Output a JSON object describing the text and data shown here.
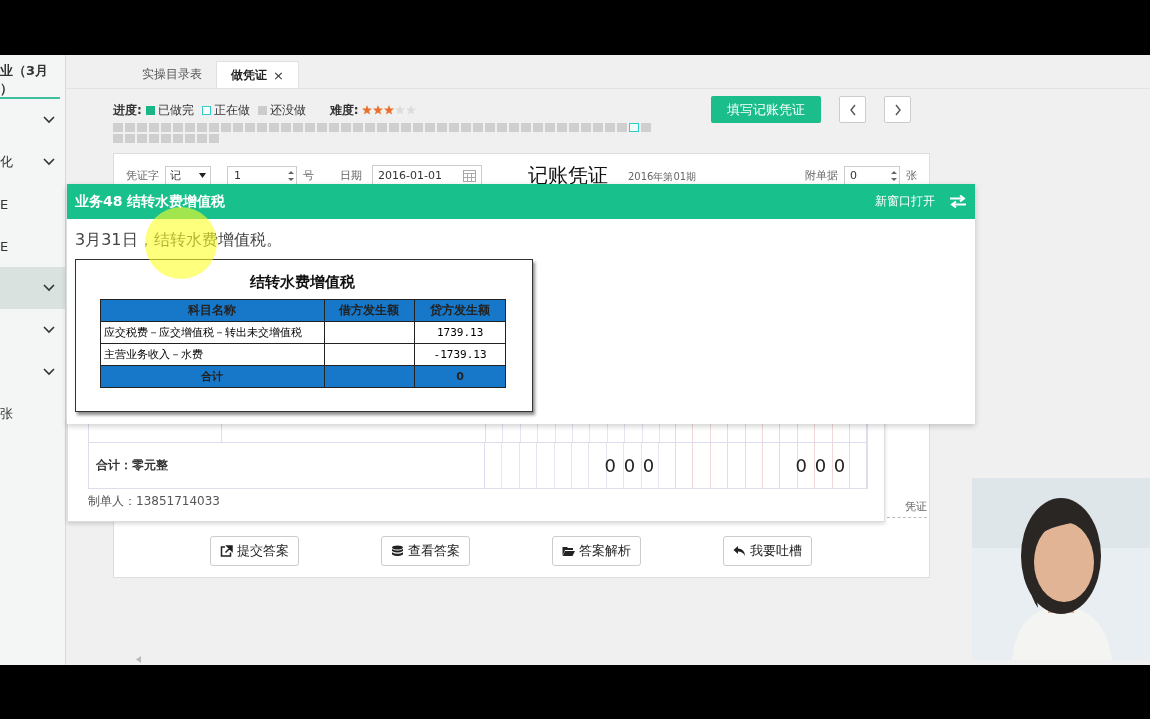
{
  "sidebar": {
    "header": [
      "业（3月",
      "）"
    ],
    "items": [
      {
        "kind": "group",
        "selected": false
      },
      {
        "kind": "group",
        "label": "化",
        "selected": false
      },
      {
        "kind": "link",
        "label": "E",
        "selected": false
      },
      {
        "kind": "link",
        "label": "E",
        "selected": false
      },
      {
        "kind": "group",
        "selected": true
      },
      {
        "kind": "group",
        "selected": false
      },
      {
        "kind": "group",
        "selected": false
      },
      {
        "kind": "link",
        "label": "张",
        "selected": false
      }
    ]
  },
  "tabs": [
    {
      "label": "实操目录表",
      "selected": false
    },
    {
      "label": "做凭证",
      "selected": true,
      "close": "×"
    }
  ],
  "progress": {
    "label": "进度:",
    "legend": [
      {
        "kind": "done",
        "label": "已做完"
      },
      {
        "kind": "doing",
        "label": "正在做"
      },
      {
        "kind": "todo",
        "label": "还没做"
      }
    ],
    "difficulty_label": "难度:",
    "stars": 3,
    "cells": [
      {
        "selected": false
      },
      {
        "selected": false
      },
      {
        "selected": false
      },
      {
        "selected": false
      },
      {
        "selected": false
      },
      {
        "selected": false
      },
      {
        "selected": false
      },
      {
        "selected": false
      },
      {
        "selected": false
      },
      {
        "selected": false
      },
      {
        "selected": false
      },
      {
        "selected": false
      },
      {
        "selected": false
      },
      {
        "selected": false
      },
      {
        "selected": false
      },
      {
        "selected": false
      },
      {
        "selected": false
      },
      {
        "selected": false
      },
      {
        "selected": false
      },
      {
        "selected": false
      },
      {
        "selected": false
      },
      {
        "selected": false
      },
      {
        "selected": false
      },
      {
        "selected": false
      },
      {
        "selected": false
      },
      {
        "selected": false
      },
      {
        "selected": false
      },
      {
        "selected": false
      },
      {
        "selected": false
      },
      {
        "selected": false
      },
      {
        "selected": false
      },
      {
        "selected": false
      },
      {
        "selected": false
      },
      {
        "selected": false
      },
      {
        "selected": false
      },
      {
        "selected": false
      },
      {
        "selected": false
      },
      {
        "selected": false
      },
      {
        "selected": false
      },
      {
        "selected": false
      },
      {
        "selected": false
      },
      {
        "selected": false
      },
      {
        "selected": false
      },
      {
        "selected": true
      },
      {
        "selected": false
      },
      {
        "selected": false
      },
      {
        "selected": false
      },
      {
        "selected": false
      },
      {
        "selected": false
      },
      {
        "selected": false
      },
      {
        "selected": false
      },
      {
        "selected": false
      },
      {
        "selected": false
      },
      {
        "selected": false
      }
    ]
  },
  "primary_button": "填写记账凭证",
  "voucher": {
    "type_label": "凭证字",
    "type_value": "记",
    "number": "1",
    "number_suffix": "号",
    "date_label": "日期",
    "date": "2016-01-01",
    "title": "记账凭证",
    "period": "2016年第01期",
    "attach_label": "附单据",
    "attach_value": "0",
    "attach_suffix": "张",
    "total_label": "合计：零元整",
    "debit_total": "000",
    "credit_total": "000",
    "maker": "制单人：13851714033",
    "side_text": "凭证",
    "actions": [
      {
        "kind": "external",
        "label": "提交答案"
      },
      {
        "kind": "database",
        "label": "查看答案"
      },
      {
        "kind": "folder",
        "label": "答案解析"
      },
      {
        "kind": "reply",
        "label": "我要吐槽"
      }
    ]
  },
  "task": {
    "title": "业务48 结转水费增值税",
    "open_new": "新窗口打开",
    "description": "3月31日，结转水费增值税。",
    "document": {
      "title": "结转水费增值税",
      "columns": [
        "科目名称",
        "借方发生额",
        "贷方发生额"
      ],
      "rows": [
        {
          "account": "应交税费－应交增值税－转出未交增值税",
          "credit": "1739.13"
        },
        {
          "account": "主营业务收入－水费",
          "credit": "-1739.13"
        }
      ],
      "total": {
        "label": "合计",
        "credit": "0"
      }
    }
  }
}
